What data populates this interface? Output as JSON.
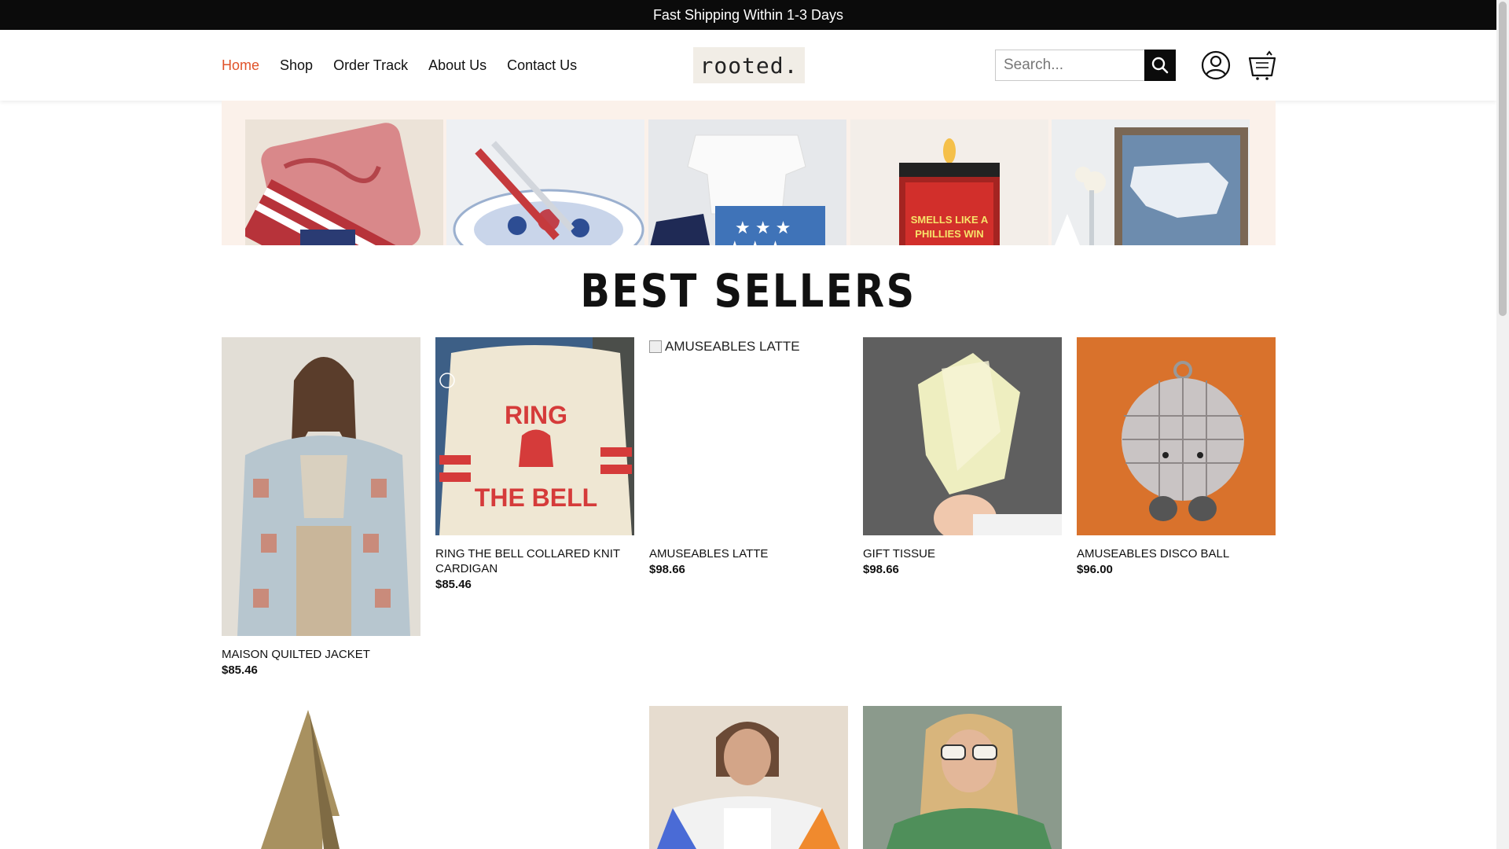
{
  "announcement": "Fast Shipping Within 1-3 Days",
  "nav": [
    {
      "label": "Home"
    },
    {
      "label": "Shop"
    },
    {
      "label": "Order Track"
    },
    {
      "label": "About Us"
    },
    {
      "label": "Contact Us"
    }
  ],
  "logo": "rooted.",
  "search": {
    "placeholder": "Search..."
  },
  "banner": {
    "candle_text": "SMELLS LIKE A PHILLIES WIN"
  },
  "section_title": "BEST SELLERS",
  "products": [
    {
      "name": "MAISON QUILTED JACKET",
      "price": "$85.46"
    },
    {
      "name": "RING THE BELL COLLARED KNIT CARDIGAN",
      "price": "$85.46",
      "artwork_text": "RING THE BELL"
    },
    {
      "name": "AMUSEABLES LATTE",
      "price": "$98.66",
      "alt": "AMUSEABLES LATTE"
    },
    {
      "name": "GIFT TISSUE",
      "price": "$98.66"
    },
    {
      "name": "AMUSEABLES DISCO BALL",
      "price": "$96.00"
    }
  ],
  "colors": {
    "accent": "#e0532a",
    "dark": "#0b0b0b",
    "banner_bg": "#fbf1ea"
  }
}
